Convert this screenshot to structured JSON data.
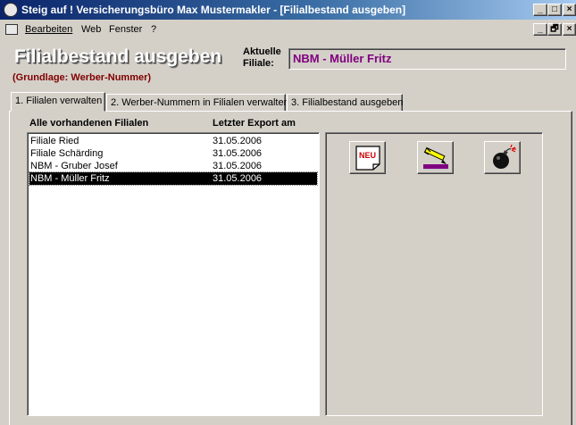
{
  "window": {
    "title": "Steig auf ! Versicherungsbüro Max Mustermakler - [Filialbestand ausgeben]",
    "controls": [
      "_",
      "□",
      "×"
    ]
  },
  "menu": {
    "items": [
      {
        "label": "Bearbeiten"
      },
      {
        "label": "Web"
      },
      {
        "label": "Fenster"
      },
      {
        "label": "?"
      }
    ],
    "doc_controls": [
      "_",
      "🗗",
      "×"
    ]
  },
  "header": {
    "title": "Filialbestand ausgeben",
    "subtitle": "(Grundlage: Werber-Nummer)",
    "branch_label_line1": "Aktuelle",
    "branch_label_line2": "Filiale:",
    "branch_value": "NBM - Müller Fritz"
  },
  "tabs": [
    {
      "label": "1. Filialen verwalten",
      "active": true
    },
    {
      "label": "2. Werber-Nummern in Filialen verwalten",
      "active": false
    },
    {
      "label": "3. Filialbestand ausgeben",
      "active": false
    }
  ],
  "list": {
    "col_name": "Alle vorhandenen Filialen",
    "col_export": "Letzter Export am",
    "rows": [
      {
        "name": "Filiale Ried",
        "date": "31.05.2006",
        "selected": false
      },
      {
        "name": "Filiale Schärding",
        "date": "31.05.2006",
        "selected": false
      },
      {
        "name": "NBM - Gruber Josef",
        "date": "31.05.2006",
        "selected": false
      },
      {
        "name": "NBM - Müller Fritz",
        "date": "31.05.2006",
        "selected": true
      }
    ]
  },
  "buttons": {
    "new_label": "NEU",
    "new_icon": "new-document-icon",
    "edit_icon": "edit-pencil-icon",
    "delete_icon": "bomb-icon"
  },
  "colors": {
    "title_gradient_start": "#0a246a",
    "title_gradient_end": "#a6caf0",
    "subtitle": "#800000",
    "branch_value": "#800080",
    "selection": "#000000"
  }
}
